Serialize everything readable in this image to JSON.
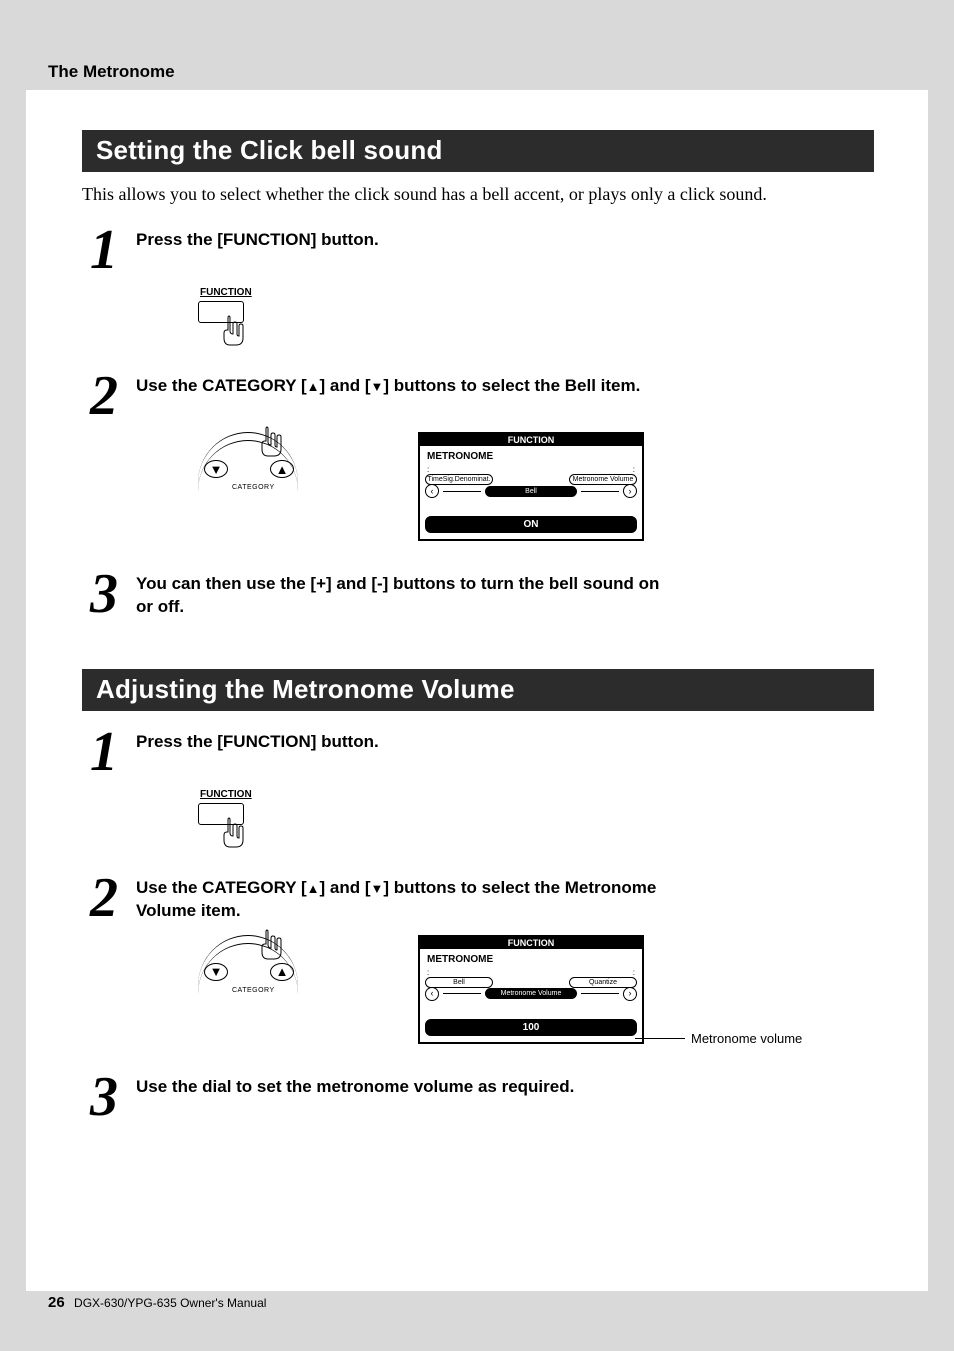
{
  "header": {
    "breadcrumb": "The Metronome"
  },
  "section1": {
    "title": "Setting the Click bell sound",
    "intro": "This allows you to select whether the click sound has a bell accent, or plays only a click sound.",
    "steps": {
      "s1": {
        "num": "1",
        "text": "Press the [FUNCTION] button."
      },
      "s2": {
        "num": "2",
        "text_a": "Use the CATEGORY [",
        "text_b": "] and [",
        "text_c": "] buttons to select the Bell item."
      },
      "s3": {
        "num": "3",
        "text": "You can then use the [+] and [-] buttons to turn the bell sound on or off."
      }
    },
    "fn_label": "FUNCTION",
    "cat_label": "CATEGORY",
    "lcd": {
      "titlebar": "FUNCTION",
      "subcat": "METRONOME",
      "tab_left": "TimeSig.Denominat.",
      "tab_right": "Metronome Volume",
      "center": "Bell",
      "main": "ON"
    }
  },
  "section2": {
    "title": "Adjusting the Metronome Volume",
    "steps": {
      "s1": {
        "num": "1",
        "text": "Press the [FUNCTION] button."
      },
      "s2": {
        "num": "2",
        "text_a": "Use the CATEGORY [",
        "text_b": "] and [",
        "text_c": "] buttons to select the Metronome Volume item."
      },
      "s3": {
        "num": "3",
        "text": "Use the dial to set the metronome volume as required."
      }
    },
    "fn_label": "FUNCTION",
    "cat_label": "CATEGORY",
    "lcd": {
      "titlebar": "FUNCTION",
      "subcat": "METRONOME",
      "tab_left": "Bell",
      "tab_right": "Quantize",
      "center": "Metronome Volume",
      "main": "100"
    },
    "annotation": "Metronome volume"
  },
  "footer": {
    "page": "26",
    "manual": "DGX-630/YPG-635  Owner's Manual"
  },
  "glyphs": {
    "up": "▲",
    "down": "▼",
    "tick": ":"
  }
}
